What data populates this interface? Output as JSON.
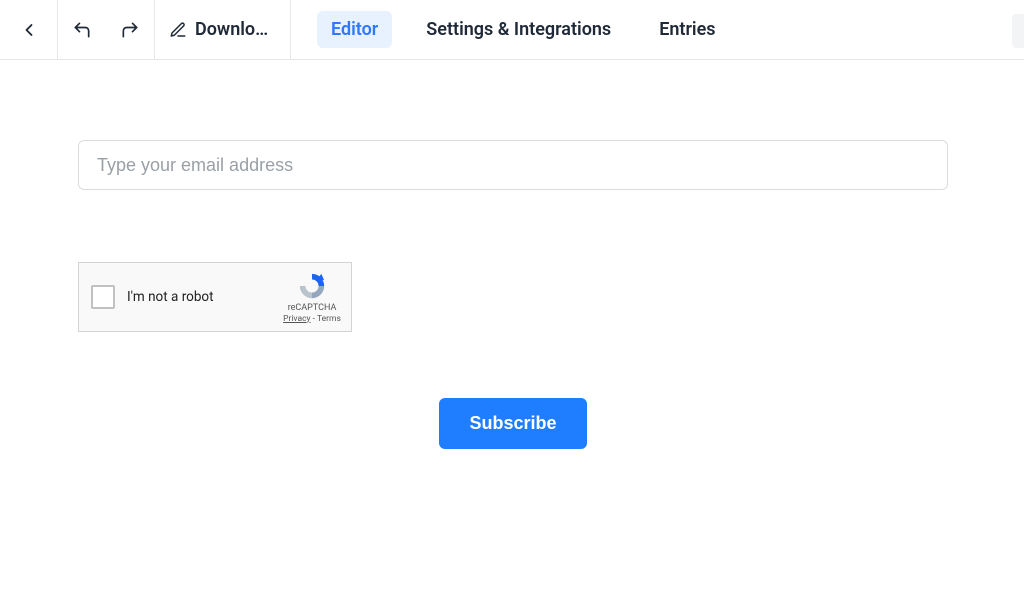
{
  "toolbar": {
    "form_name": "Downlo…"
  },
  "tabs": {
    "editor": "Editor",
    "settings": "Settings & Integrations",
    "entries": "Entries",
    "active": "editor"
  },
  "form": {
    "email_placeholder": "Type your email address",
    "submit_label": "Subscribe"
  },
  "recaptcha": {
    "label": "I'm not a robot",
    "brand": "reCAPTCHA",
    "privacy": "Privacy",
    "separator": " - ",
    "terms": "Terms"
  }
}
